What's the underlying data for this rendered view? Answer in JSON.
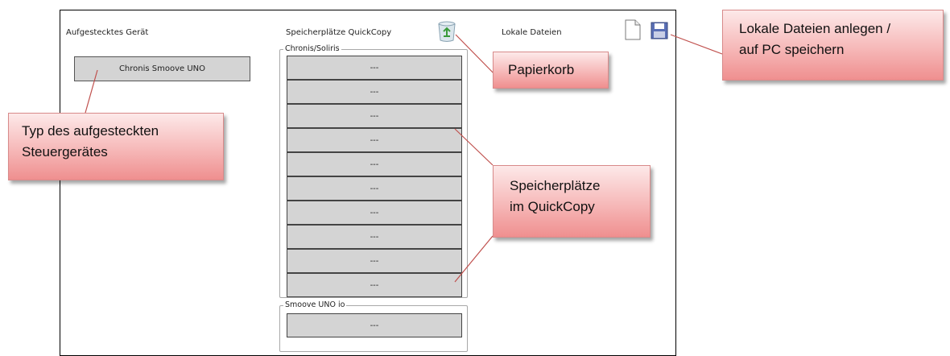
{
  "window": {
    "headers": {
      "device": "Aufgestecktes Gerät",
      "quickcopy": "Speicherplätze QuickCopy",
      "local": "Lokale Dateien"
    },
    "device_button": "Chronis Smoove UNO",
    "groups": {
      "chronis_label": "Chronis/Soliris",
      "chronis_slots": [
        "---",
        "---",
        "---",
        "---",
        "---",
        "---",
        "---",
        "---",
        "---",
        "---"
      ],
      "smoove_label": "Smoove UNO io",
      "smoove_slots": [
        "---"
      ]
    },
    "icons": {
      "recycle_bin": "recycle-bin-icon",
      "new_file": "new-file-icon",
      "save": "floppy-disk-icon"
    }
  },
  "callouts": {
    "papierkorb": [
      "Papierkorb"
    ],
    "local_files": [
      "Lokale Dateien anlegen /",
      "auf PC speichern"
    ],
    "device_type": [
      "Typ des aufgesteckten",
      "Steuergerätes"
    ],
    "slots": [
      "Speicherplätze",
      "im QuickCopy"
    ]
  },
  "colors": {
    "callout_top": "#fde9e9",
    "callout_bottom": "#ef8f8f",
    "callout_line": "#c0504d",
    "slot_fill": "#d4d4d4"
  }
}
